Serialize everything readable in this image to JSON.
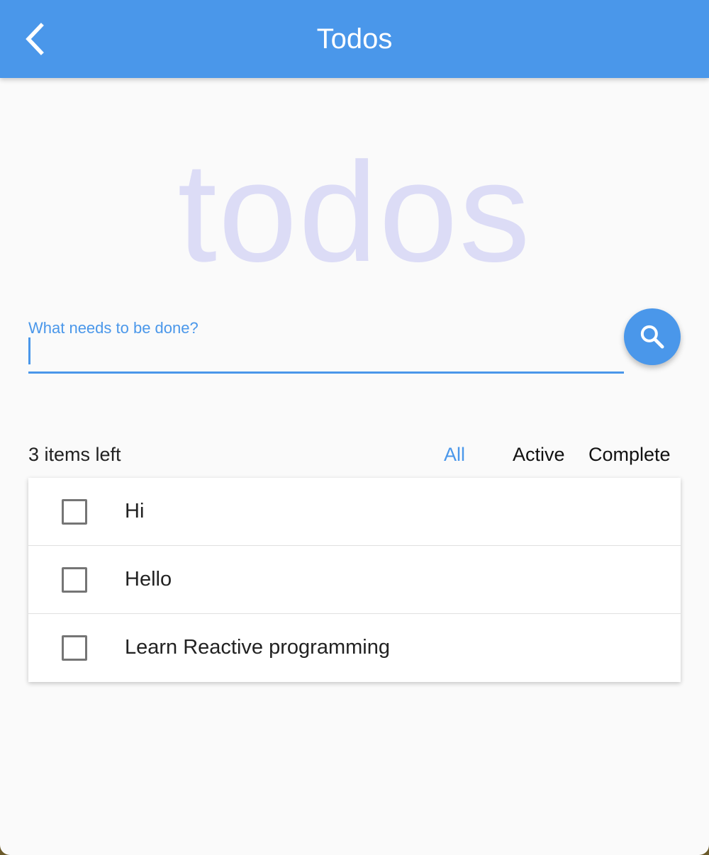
{
  "appbar": {
    "title": "Todos",
    "back_icon": "chevron-left-icon",
    "background": "#4a97ea"
  },
  "hero": {
    "text": "todos",
    "color": "#dcdcf6"
  },
  "new_todo": {
    "label": "What needs to be done?",
    "value": "",
    "accent": "#4a97ea"
  },
  "search_button": {
    "icon": "search-icon"
  },
  "footer": {
    "items_left": "3 items left",
    "filters": [
      {
        "label": "All",
        "selected": true
      },
      {
        "label": "Active",
        "selected": false
      },
      {
        "label": "Complete",
        "selected": false
      }
    ]
  },
  "todos": [
    {
      "text": "Hi",
      "completed": false
    },
    {
      "text": "Hello",
      "completed": false
    },
    {
      "text": "Learn Reactive programming",
      "completed": false
    }
  ]
}
